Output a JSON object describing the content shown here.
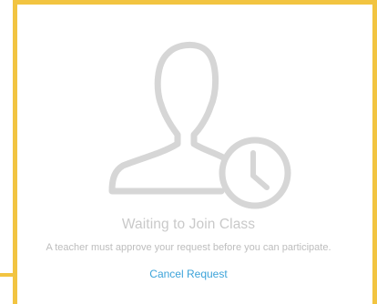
{
  "status": {
    "title": "Waiting to Join Class",
    "message": "A teacher must approve your request before you can participate.",
    "cancel_label": "Cancel Request"
  },
  "icons": {
    "illustration": "user-clock-icon"
  },
  "colors": {
    "border": "#F2C441",
    "link": "#3CA3D9",
    "muted_text": "#C9C9C9",
    "icon_stroke": "#D6D6D6"
  }
}
